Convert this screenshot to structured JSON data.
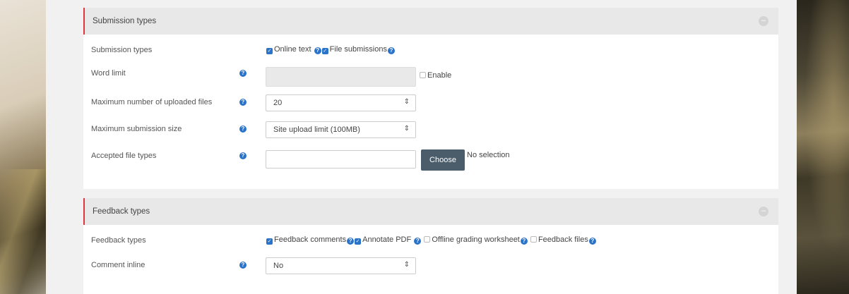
{
  "submission": {
    "header": "Submission types",
    "types_label": "Submission types",
    "types_options": [
      {
        "label": "Online text",
        "checked": true
      },
      {
        "label": "File submissions",
        "checked": true
      }
    ],
    "word_limit_label": "Word limit",
    "enable_label": "Enable",
    "max_files_label": "Maximum number of uploaded files",
    "max_files_value": "20",
    "max_size_label": "Maximum submission size",
    "max_size_value": "Site upload limit (100MB)",
    "accepted_label": "Accepted file types",
    "choose_label": "Choose",
    "no_selection": "No selection"
  },
  "feedback": {
    "header": "Feedback types",
    "types_label": "Feedback types",
    "types_options": [
      {
        "label": "Feedback comments",
        "checked": true
      },
      {
        "label": "Annotate PDF",
        "checked": true
      },
      {
        "label": "Offline grading worksheet",
        "checked": false
      },
      {
        "label": "Feedback files",
        "checked": false
      }
    ],
    "comment_inline_label": "Comment inline",
    "comment_inline_value": "No"
  },
  "colors": {
    "accent": "#e0353d",
    "help_icon": "#2a73c9",
    "button": "#4b5c6b"
  }
}
